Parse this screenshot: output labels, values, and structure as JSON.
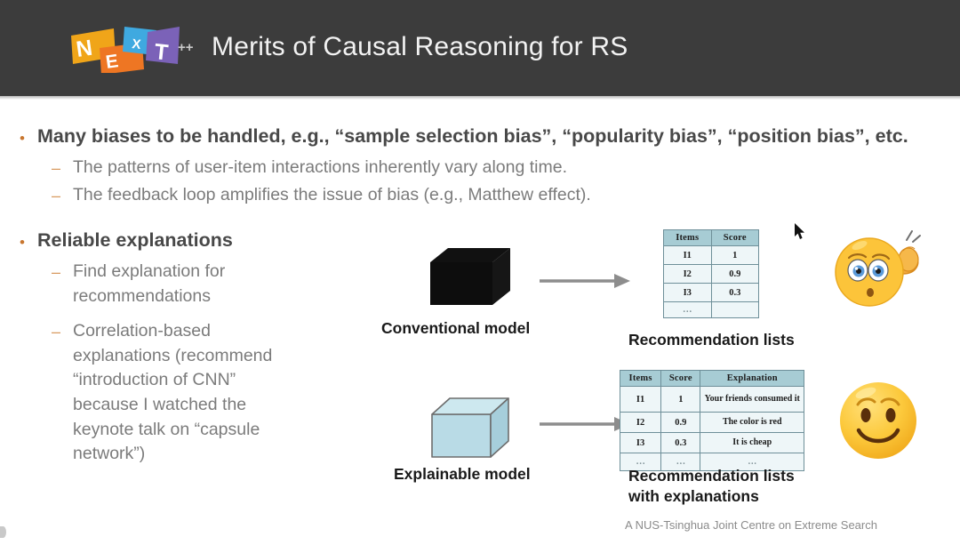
{
  "header": {
    "title": "Merits of Causal Reasoning for RS",
    "logo": {
      "letters": [
        "N",
        "E",
        "X",
        "T"
      ],
      "suffix": "++",
      "colors": [
        "#f0a519",
        "#ee7623",
        "#3fa9e0",
        "#7b62b8"
      ]
    },
    "background_color": "#3c3c3c"
  },
  "content": {
    "bullets": [
      {
        "marker": "•",
        "text": "Many biases to be handled, e.g., “sample selection bias”, “popularity bias”, “position  bias”,  etc.",
        "sub": [
          {
            "marker": "–",
            "text": "The patterns of user-item interactions inherently vary along time."
          },
          {
            "marker": "–",
            "text": "The feedback loop amplifies the issue of bias (e.g., Matthew effect)."
          }
        ]
      },
      {
        "marker": "•",
        "text": "Reliable explanations",
        "sub": [
          {
            "marker": "–",
            "text": "Find explanation for recommendations"
          },
          {
            "marker": "–",
            "text": "Correlation-based explanations (recommend “introduction of CNN” because I watched the keynote talk on “capsule network”)"
          }
        ]
      }
    ]
  },
  "diagram": {
    "row_top": {
      "model_caption": "Conventional model",
      "model_color": "#0d0d0d",
      "output_caption": "Recommendation lists",
      "emoji": "confused-face-scratching-head",
      "table": {
        "headers": [
          "Items",
          "Score"
        ],
        "rows": [
          [
            "I1",
            "1"
          ],
          [
            "I2",
            "0.9"
          ],
          [
            "I3",
            "0.3"
          ],
          [
            "…",
            ""
          ]
        ]
      }
    },
    "row_bottom": {
      "model_caption": "Explainable model",
      "model_color": "#b6dde8",
      "output_caption_line1": "Recommendation lists",
      "output_caption_line2": "with explanations",
      "emoji": "smiling-face",
      "table": {
        "headers": [
          "Items",
          "Score",
          "Explanation"
        ],
        "rows": [
          [
            "I1",
            "1",
            "Your friends consumed it"
          ],
          [
            "I2",
            "0.9",
            "The color is red"
          ],
          [
            "I3",
            "0.3",
            "It is cheap"
          ],
          [
            "…",
            "…",
            "…"
          ]
        ]
      }
    },
    "arrow_color": "#8d8d8d"
  },
  "footer": {
    "note": "A NUS-Tsinghua Joint Centre on Extreme Search"
  },
  "theme": {
    "bullet_color": "#c8762f",
    "dash_color": "#d89a60",
    "level1_text_color": "#484848",
    "level2_text_color": "#7b7b7b",
    "table_header_bg": "#a7ccd4",
    "table_cell_bg": "#eef6f8",
    "table_border": "#6e8f99"
  }
}
